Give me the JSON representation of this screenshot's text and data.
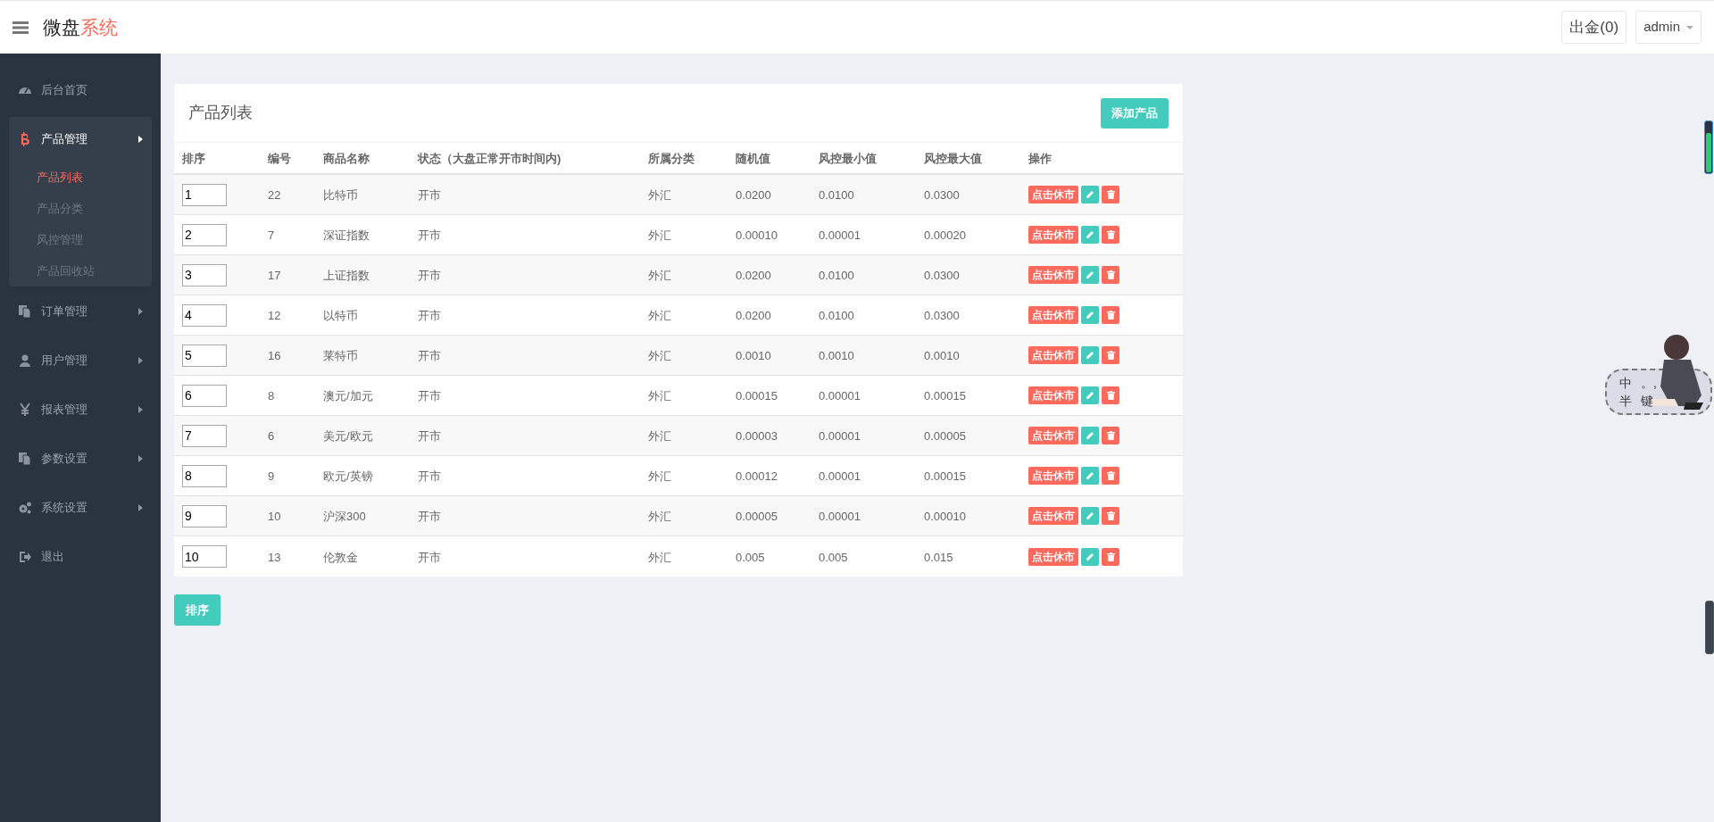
{
  "header": {
    "logo_main": "微盘",
    "logo_accent": "系统",
    "withdraw": "出金(0)",
    "user": "admin"
  },
  "sidebar": {
    "items": [
      {
        "label": "后台首页",
        "expanded": false,
        "has_arrow": false
      },
      {
        "label": "产品管理",
        "expanded": true,
        "has_arrow": true,
        "children": [
          {
            "label": "产品列表",
            "selected": true
          },
          {
            "label": "产品分类",
            "selected": false
          },
          {
            "label": "风控管理",
            "selected": false
          },
          {
            "label": "产品回收站",
            "selected": false
          }
        ]
      },
      {
        "label": "订单管理",
        "expanded": false,
        "has_arrow": true
      },
      {
        "label": "用户管理",
        "expanded": false,
        "has_arrow": true
      },
      {
        "label": "报表管理",
        "expanded": false,
        "has_arrow": true
      },
      {
        "label": "参数设置",
        "expanded": false,
        "has_arrow": true
      },
      {
        "label": "系统设置",
        "expanded": false,
        "has_arrow": true
      },
      {
        "label": "退出",
        "expanded": false,
        "has_arrow": false
      }
    ]
  },
  "card": {
    "title": "产品列表",
    "add_button": "添加产品"
  },
  "table": {
    "columns": [
      "排序",
      "编号",
      "商品名称",
      "状态（大盘正常开市时间内)",
      "所属分类",
      "随机值",
      "风控最小值",
      "风控最大值",
      "操作"
    ],
    "rows": [
      {
        "order": "1",
        "id": "22",
        "name": "比特币",
        "status": "开市",
        "category": "外汇",
        "random": "0.0200",
        "min": "0.0100",
        "max": "0.0300",
        "action": "点击休市"
      },
      {
        "order": "2",
        "id": "7",
        "name": "深证指数",
        "status": "开市",
        "category": "外汇",
        "random": "0.00010",
        "min": "0.00001",
        "max": "0.00020",
        "action": "点击休市"
      },
      {
        "order": "3",
        "id": "17",
        "name": "上证指数",
        "status": "开市",
        "category": "外汇",
        "random": "0.0200",
        "min": "0.0100",
        "max": "0.0300",
        "action": "点击休市"
      },
      {
        "order": "4",
        "id": "12",
        "name": "以特币",
        "status": "开市",
        "category": "外汇",
        "random": "0.0200",
        "min": "0.0100",
        "max": "0.0300",
        "action": "点击休市"
      },
      {
        "order": "5",
        "id": "16",
        "name": "莱特币",
        "status": "开市",
        "category": "外汇",
        "random": "0.0010",
        "min": "0.0010",
        "max": "0.0010",
        "action": "点击休市"
      },
      {
        "order": "6",
        "id": "8",
        "name": "澳元/加元",
        "status": "开市",
        "category": "外汇",
        "random": "0.00015",
        "min": "0.00001",
        "max": "0.00015",
        "action": "点击休市"
      },
      {
        "order": "7",
        "id": "6",
        "name": "美元/欧元",
        "status": "开市",
        "category": "外汇",
        "random": "0.00003",
        "min": "0.00001",
        "max": "0.00005",
        "action": "点击休市"
      },
      {
        "order": "8",
        "id": "9",
        "name": "欧元/英镑",
        "status": "开市",
        "category": "外汇",
        "random": "0.00012",
        "min": "0.00001",
        "max": "0.00015",
        "action": "点击休市"
      },
      {
        "order": "9",
        "id": "10",
        "name": "沪深300",
        "status": "开市",
        "category": "外汇",
        "random": "0.00005",
        "min": "0.00001",
        "max": "0.00010",
        "action": "点击休市"
      },
      {
        "order": "10",
        "id": "13",
        "name": "伦敦金",
        "status": "开市",
        "category": "外汇",
        "random": "0.005",
        "min": "0.005",
        "max": "0.015",
        "action": "点击休市"
      }
    ]
  },
  "sort_button": "排序",
  "ime_widget": {
    "line1": [
      "中",
      "。,"
    ],
    "line2": [
      "半",
      "键"
    ]
  }
}
